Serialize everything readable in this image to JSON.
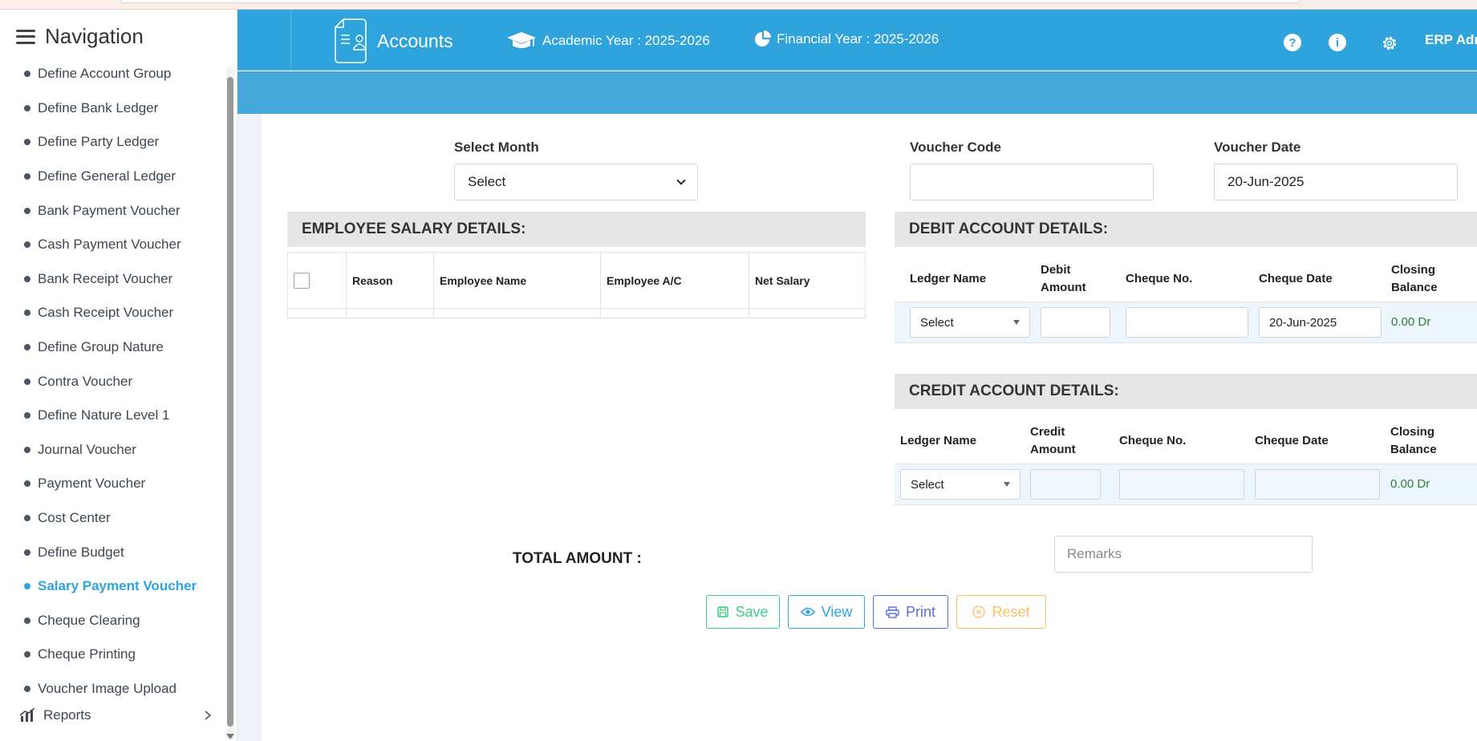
{
  "sidebar": {
    "title": "Navigation",
    "items": [
      {
        "label": "Define Account Group"
      },
      {
        "label": "Define Bank Ledger"
      },
      {
        "label": "Define Party Ledger"
      },
      {
        "label": "Define General Ledger"
      },
      {
        "label": "Bank Payment Voucher"
      },
      {
        "label": "Cash Payment Voucher"
      },
      {
        "label": "Bank Receipt Voucher"
      },
      {
        "label": "Cash Receipt Voucher"
      },
      {
        "label": "Define Group Nature"
      },
      {
        "label": "Contra Voucher"
      },
      {
        "label": "Define Nature Level 1"
      },
      {
        "label": "Journal Voucher"
      },
      {
        "label": "Payment Voucher"
      },
      {
        "label": "Cost Center"
      },
      {
        "label": "Define Budget"
      },
      {
        "label": "Salary Payment Voucher",
        "active": true
      },
      {
        "label": "Cheque Clearing"
      },
      {
        "label": "Cheque Printing"
      },
      {
        "label": "Voucher Image Upload"
      }
    ],
    "reports_label": "Reports"
  },
  "header": {
    "app_name": "Accounts",
    "academic_year": "Academic Year : 2025-2026",
    "financial_year": "Financial Year : 2025-2026",
    "user": "ERP Adr",
    "help_glyph": "?",
    "info_glyph": "i"
  },
  "form": {
    "select_month_label": "Select Month",
    "select_month_value": "Select",
    "voucher_code_label": "Voucher Code",
    "voucher_code_value": "",
    "voucher_date_label": "Voucher Date",
    "voucher_date_value": "20-Jun-2025"
  },
  "employee_section": {
    "title": "EMPLOYEE SALARY DETAILS:",
    "columns": [
      "",
      "Reason",
      "Employee Name",
      "Employee A/C",
      "Net Salary"
    ]
  },
  "debit_section": {
    "title": "DEBIT ACCOUNT DETAILS:",
    "columns": [
      "Ledger Name",
      "Debit Amount",
      "Cheque No.",
      "Cheque Date",
      "Closing Balance"
    ],
    "row": {
      "ledger": "Select",
      "amount": "",
      "cheque_no": "",
      "cheque_date": "20-Jun-2025",
      "closing_balance": "0.00 Dr"
    }
  },
  "credit_section": {
    "title": "CREDIT ACCOUNT DETAILS:",
    "columns": [
      "Ledger Name",
      "Credit Amount",
      "Cheque No.",
      "Cheque Date",
      "Closing Balance"
    ],
    "row": {
      "ledger": "Select",
      "amount": "",
      "cheque_no": "",
      "cheque_date": "",
      "closing_balance": "0.00 Dr"
    }
  },
  "footer": {
    "total_label": "TOTAL AMOUNT :",
    "remarks_placeholder": "Remarks",
    "buttons": {
      "save": "Save",
      "view": "View",
      "print": "Print",
      "reset": "Reset"
    }
  },
  "colors": {
    "header_blue": "#2ea3dc",
    "active_item": "#2ea3dc",
    "save": "#3ccf83",
    "print": "#5b6ed6",
    "reset": "#ffbd63",
    "balance": "#2e7d32"
  }
}
